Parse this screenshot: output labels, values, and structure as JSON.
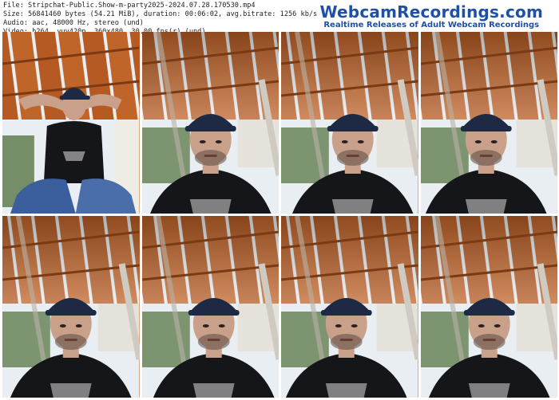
{
  "file_info": {
    "file_line": "File: Stripchat-Public.Show-m-party2025-2024.07.28.170530.mp4",
    "size_line": "Size: 56841460 bytes (54.21 MiB), duration: 00:06:02, avg.bitrate: 1256 kb/s",
    "audio_line": "Audio: aac, 48000 Hz, stereo (und)",
    "video_line": "Video: h264, yuv420p, 360x480, 30.00 fps(r) (und)"
  },
  "brand": {
    "title": "WebcamRecordings.com",
    "tagline": "Realtime Releases of Adult Webcam Recordings"
  },
  "thumbnails": [
    {
      "scene": "seated-hands-behind-head"
    },
    {
      "scene": "closeup-face"
    },
    {
      "scene": "closeup-face"
    },
    {
      "scene": "closeup-face"
    },
    {
      "scene": "closeup-face"
    },
    {
      "scene": "closeup-face"
    },
    {
      "scene": "closeup-face"
    },
    {
      "scene": "closeup-face"
    }
  ],
  "colors": {
    "brand_blue": "#1f4fa6",
    "wood": "#c0652a",
    "wood_dark": "#7a3a14",
    "cap": "#1e2a44",
    "shirt": "#15161a",
    "skin": "#c9a08a",
    "sky": "#e9eef2",
    "foliage": "#4f6d3a"
  }
}
